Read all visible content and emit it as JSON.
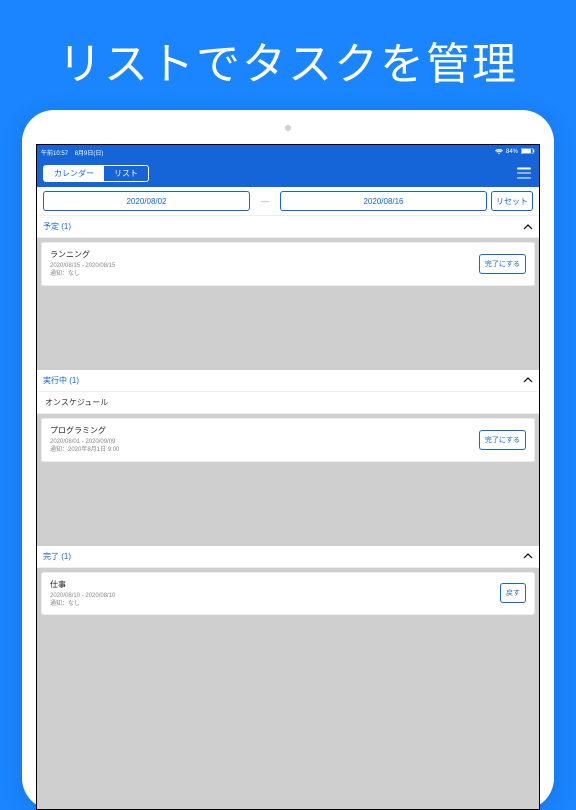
{
  "hero": "リストでタスクを管理",
  "statusbar": {
    "time": "午前10:57",
    "date": "8月9日(日)",
    "battery": "84%"
  },
  "toolbar": {
    "tab_calendar": "カレンダー",
    "tab_list": "リスト"
  },
  "filter": {
    "date_from": "2020/08/02",
    "date_to": "2020/08/16",
    "reset": "リセット",
    "dash": "—"
  },
  "sections": {
    "scheduled": {
      "label": "予定 (1)"
    },
    "in_progress": {
      "label": "実行中 (1)",
      "subheader": "オンスケジュール"
    },
    "done": {
      "label": "完了 (1)"
    }
  },
  "tasks": {
    "running": {
      "title": "ランニング",
      "dates": "2020/08/15 - 2020/08/15",
      "notify": "通知：なし",
      "action": "完了にする"
    },
    "programming": {
      "title": "プログラミング",
      "dates": "2020/08/01 - 2020/09/09",
      "notify": "通知：2020年8月1日 9:00",
      "action": "完了にする"
    },
    "work": {
      "title": "仕事",
      "dates": "2020/08/10 - 2020/08/10",
      "notify": "通知：なし",
      "action": "戻す"
    }
  }
}
